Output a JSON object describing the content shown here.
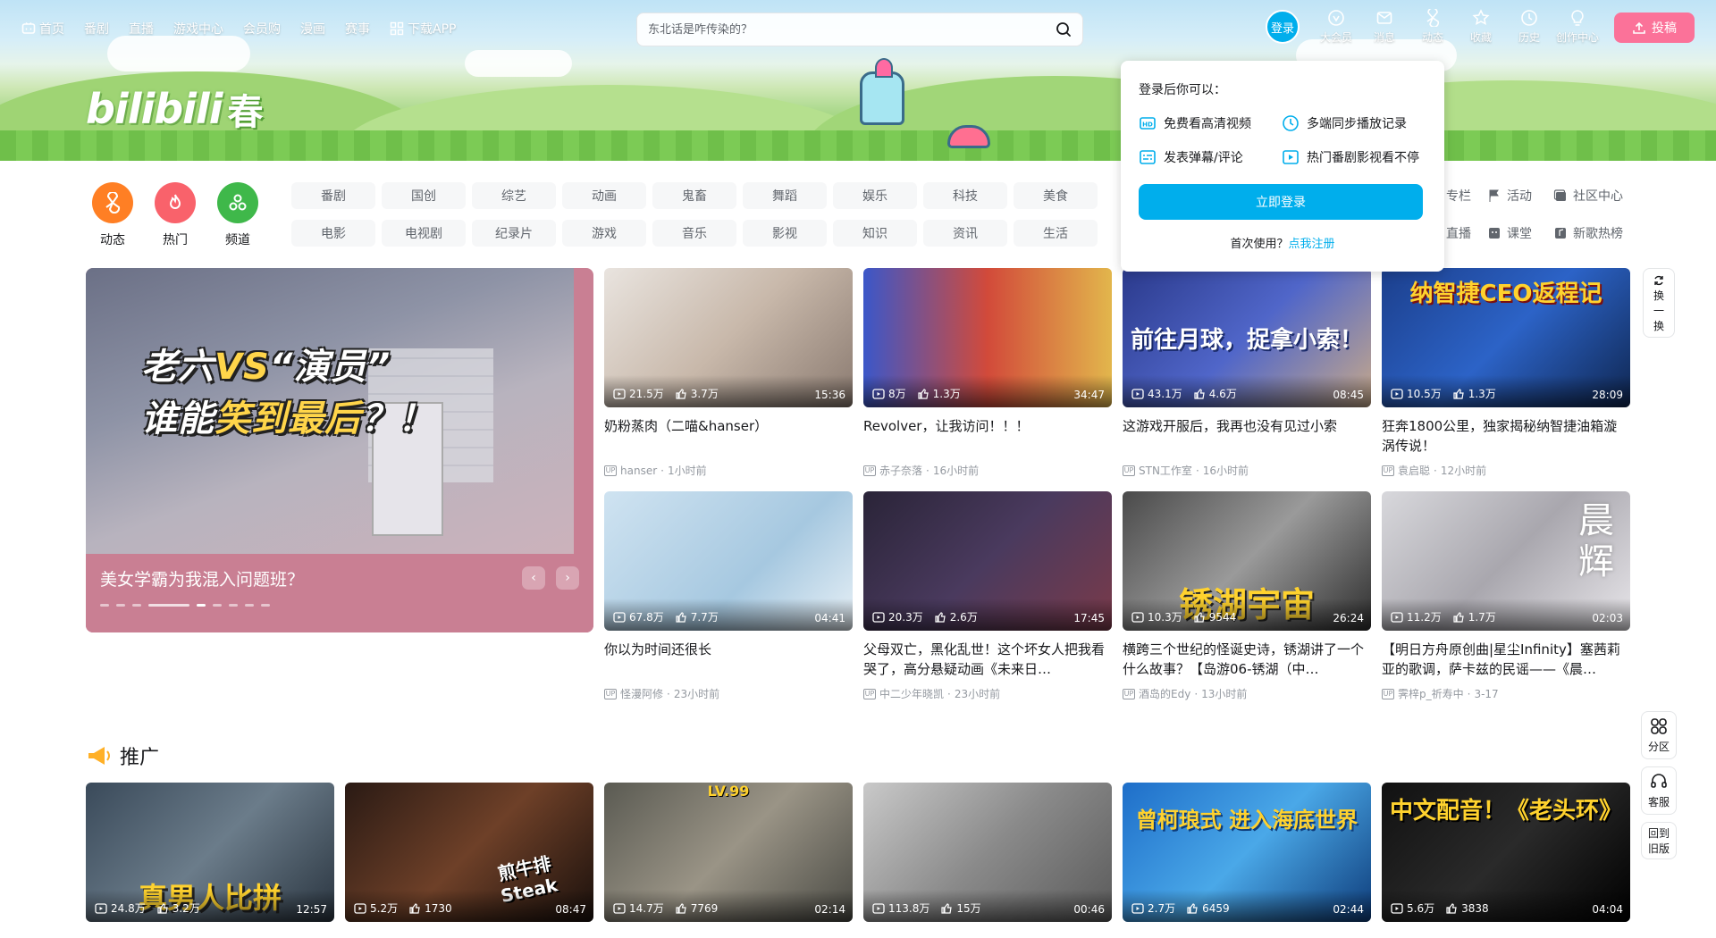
{
  "nav": {
    "left": [
      {
        "id": "home",
        "label": "首页"
      },
      {
        "id": "bangumi",
        "label": "番剧"
      },
      {
        "id": "live",
        "label": "直播"
      },
      {
        "id": "game",
        "label": "游戏中心"
      },
      {
        "id": "shop",
        "label": "会员购"
      },
      {
        "id": "manga",
        "label": "漫画"
      },
      {
        "id": "match",
        "label": "赛事"
      },
      {
        "id": "app",
        "label": "下载APP"
      }
    ],
    "search_placeholder": "东北话是咋传染的？",
    "login_label": "登录",
    "right": [
      {
        "id": "vip",
        "label": "大会员"
      },
      {
        "id": "message",
        "label": "消息"
      },
      {
        "id": "dynamic",
        "label": "动态"
      },
      {
        "id": "fav",
        "label": "收藏"
      },
      {
        "id": "history",
        "label": "历史"
      },
      {
        "id": "creator",
        "label": "创作中心"
      }
    ],
    "upload_label": "投稿"
  },
  "banner": {
    "logo_text": "bilibili",
    "logo_badge": "春"
  },
  "channels": {
    "main": [
      {
        "label": "动态",
        "color": "#ff7f24"
      },
      {
        "label": "热门",
        "color": "#f9626b"
      },
      {
        "label": "频道",
        "color": "#3fb84a"
      }
    ],
    "grid_row1": [
      "番剧",
      "国创",
      "综艺",
      "动画",
      "鬼畜",
      "舞蹈",
      "娱乐",
      "科技",
      "美食"
    ],
    "grid_row2": [
      "电影",
      "电视剧",
      "纪录片",
      "游戏",
      "音乐",
      "影视",
      "知识",
      "资讯",
      "生活"
    ],
    "right": [
      {
        "label": "专栏",
        "icon": "column-icon"
      },
      {
        "label": "活动",
        "icon": "flag-icon"
      },
      {
        "label": "社区中心",
        "icon": "community-icon"
      },
      {
        "label": "直播",
        "icon": "live-icon"
      },
      {
        "label": "课堂",
        "icon": "class-icon"
      },
      {
        "label": "新歌热榜",
        "icon": "music-icon"
      }
    ]
  },
  "carousel": {
    "line1_a": "老六",
    "line1_b": "VS",
    "line1_c": "“演员”",
    "line2_a": "谁能",
    "line2_b": "笑到最后",
    "line2_c": "？！",
    "caption": "美女学霸为我混入问题班？",
    "prev": "‹",
    "next": "›"
  },
  "videos": [
    {
      "views": "21.5万",
      "likes": "3.7万",
      "duration": "15:36",
      "title": "奶粉蒸肉（二喵&hanser）",
      "up": "hanser",
      "time": "1小时前",
      "bg": "linear-gradient(135deg,#e9e4df,#c8b8aa 50%,#8a7a70)"
    },
    {
      "views": "8万",
      "likes": "1.3万",
      "duration": "34:47",
      "title": "Revolver，让我访问！！！",
      "up": "赤子奈落",
      "time": "16小时前",
      "bg": "linear-gradient(90deg,#3b57c9,#d24a3a 50%,#e2b64c)"
    },
    {
      "views": "43.1万",
      "likes": "4.6万",
      "duration": "08:45",
      "title": "这游戏开服后，我再也没有见过小索",
      "up": "STN工作室",
      "time": "16小时前",
      "bg": "linear-gradient(135deg,#2b3a8c,#5066c9 50%,#c7a98a)"
    },
    {
      "views": "10.5万",
      "likes": "1.3万",
      "duration": "28:09",
      "title": "狂奔1800公里，独家揭秘纳智捷油箱漩涡传说！",
      "up": "袁启聪",
      "time": "12小时前",
      "bg": "linear-gradient(135deg,#1c3f8c,#2c63c7 50%,#0f2650)"
    },
    {
      "views": "67.8万",
      "likes": "7.7万",
      "duration": "04:41",
      "title": "你以为时间还很长",
      "up": "怪漫阿修",
      "time": "23小时前",
      "bg": "linear-gradient(135deg,#cfe3f1,#a6c8e0 60%,#e7f0f6)"
    },
    {
      "views": "20.3万",
      "likes": "2.6万",
      "duration": "17:45",
      "title": "父母双亡，黑化乱世！这个坏女人把我看哭了，高分悬疑动画《未来日…",
      "up": "中二少年晓凯",
      "time": "23小时前",
      "bg": "linear-gradient(135deg,#2a2438,#4a3a5e 50%,#7a3a4a)"
    },
    {
      "views": "10.3万",
      "likes": "9544",
      "duration": "26:24",
      "title": "横跨三个世纪的怪诞史诗，锈湖讲了一个什么故事？【岛游06-锈湖（中…",
      "up": "酒岛的Edy",
      "time": "13小时前",
      "bg": "linear-gradient(135deg,#4a4a4a,#9a9a9a 50%,#2e2e2e)"
    },
    {
      "views": "11.2万",
      "likes": "1.7万",
      "duration": "02:03",
      "title": "【明日方舟原创曲|星尘Infinity】塞茜莉亚的歌调，萨卡兹的民谣——《晨…",
      "up": "霁梓p_祈寿中",
      "time": "3-17",
      "bg": "linear-gradient(135deg,#d8d8dc,#a9a7ae 50%,#e8e6ea)"
    }
  ],
  "thumb_texts": {
    "v3": "前往月球，捉拿小索！",
    "v4": "纳智捷CEO返程记",
    "v7": "锈湖宇宙",
    "v8": "晨辉"
  },
  "promo_title": "推广",
  "promo": [
    {
      "views": "24.8万",
      "likes": "3.2万",
      "duration": "12:57",
      "text": "真男人比拼",
      "bg": "linear-gradient(135deg,#3a4a5a,#6b7c8a 50%,#2a3540)"
    },
    {
      "views": "5.2万",
      "likes": "1730",
      "duration": "08:47",
      "text": "煎牛排 Steak",
      "bg": "linear-gradient(135deg,#2a1a14,#6e4028 50%,#1a100c)"
    },
    {
      "views": "14.7万",
      "likes": "7769",
      "duration": "02:14",
      "text": "LV.99",
      "bg": "linear-gradient(135deg,#5a5a52,#9a9486 50%,#4a4a44)"
    },
    {
      "views": "113.8万",
      "likes": "15万",
      "duration": "00:46",
      "text": "",
      "bg": "linear-gradient(135deg,#c9c9c9,#8a8a8a 50%,#5a5a5a)"
    },
    {
      "views": "2.7万",
      "likes": "6459",
      "duration": "02:44",
      "text": "曾柯琅式 进入海底世界",
      "bg": "linear-gradient(135deg,#1e6ec9,#4aa8e8 50%,#0e3c7a)"
    },
    {
      "views": "5.6万",
      "likes": "3838",
      "duration": "04:04",
      "text": "中文配音！《老头环》",
      "bg": "linear-gradient(135deg,#111,#2a2a2a 50%,#000)"
    }
  ],
  "side": {
    "refresh": [
      "换",
      "一",
      "换"
    ],
    "zone": "分区",
    "service": "客服",
    "old_1": "回到",
    "old_2": "旧版"
  },
  "popup": {
    "head": "登录后你可以：",
    "items": [
      "免费看高清视频",
      "多端同步播放记录",
      "发表弹幕/评论",
      "热门番剧影视看不停"
    ],
    "login_btn": "立即登录",
    "first_use": "首次使用？",
    "register": "点我注册"
  }
}
